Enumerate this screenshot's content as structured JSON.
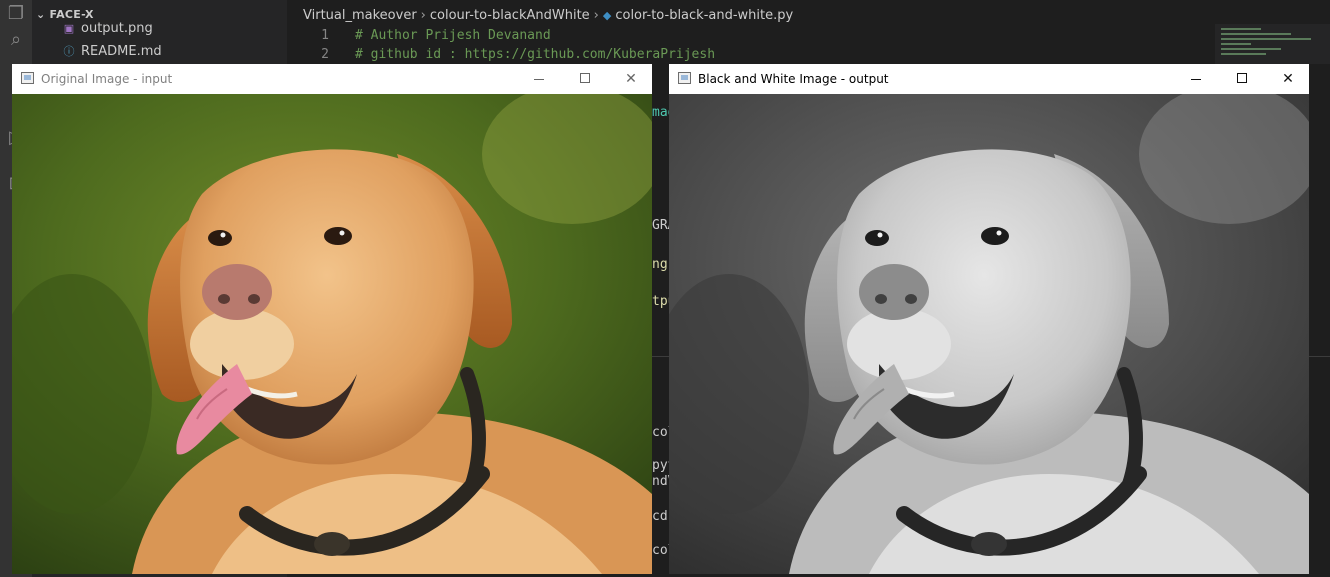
{
  "explorer": {
    "root_label": "FACE-X",
    "files": [
      {
        "name": "output.png",
        "icon": "image-file-icon"
      },
      {
        "name": "README.md",
        "icon": "info-icon"
      }
    ]
  },
  "breadcrumb": {
    "items": [
      "Virtual_makeover",
      "colour-to-blackAndWhite",
      "color-to-black-and-white.py"
    ]
  },
  "code": {
    "lines": [
      {
        "num": "1",
        "text": "# Author Prijesh Devanand"
      },
      {
        "num": "2",
        "text": "# github id : https://github.com/KuberaPrijesh"
      }
    ],
    "peeks": [
      "mag",
      "GRA",
      "ng)",
      "tpu",
      "col",
      "pyt",
      "ndV",
      "cd",
      "col"
    ]
  },
  "windows": {
    "input": {
      "title": "Original Image - input"
    },
    "output": {
      "title": "Black and White Image - output"
    }
  },
  "colors": {
    "vscode_bg": "#1e1e1e",
    "sidebar_bg": "#252526",
    "activity_bg": "#333333",
    "comment": "#6a9955"
  }
}
